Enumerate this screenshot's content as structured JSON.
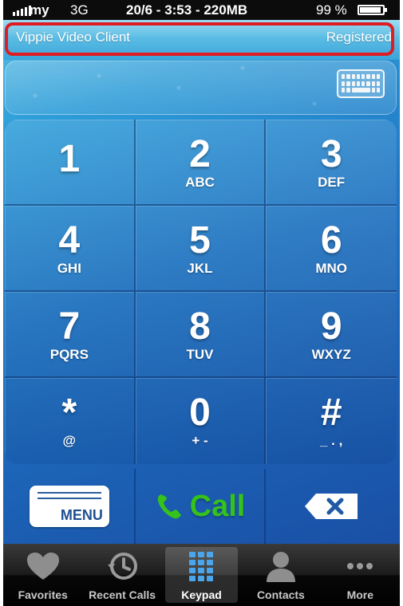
{
  "status_bar": {
    "carrier": "my",
    "network": "3G",
    "center_text": "20/6 - 3:53 - 220MB",
    "battery_percent": "99 %"
  },
  "header": {
    "title": "Vippie Video Client",
    "status": "Registered",
    "highlight_color": "#e01b22"
  },
  "display": {
    "number_value": "",
    "keyboard_icon": "keyboard-icon"
  },
  "keypad": {
    "keys": [
      {
        "digit": "1",
        "letters": ""
      },
      {
        "digit": "2",
        "letters": "ABC"
      },
      {
        "digit": "3",
        "letters": "DEF"
      },
      {
        "digit": "4",
        "letters": "GHI"
      },
      {
        "digit": "5",
        "letters": "JKL"
      },
      {
        "digit": "6",
        "letters": "MNO"
      },
      {
        "digit": "7",
        "letters": "PQRS"
      },
      {
        "digit": "8",
        "letters": "TUV"
      },
      {
        "digit": "9",
        "letters": "WXYZ"
      },
      {
        "digit": "*",
        "letters": "@"
      },
      {
        "digit": "0",
        "letters": "+ -"
      },
      {
        "digit": "#",
        "letters": "_ . ,"
      }
    ]
  },
  "actions": {
    "menu_label": "MENU",
    "call_label": "Call",
    "call_color": "#35c21b",
    "backspace_icon": "backspace-icon"
  },
  "tabbar": {
    "tabs": [
      {
        "label": "Favorites",
        "icon": "heart-icon"
      },
      {
        "label": "Recent Calls",
        "icon": "clock-icon"
      },
      {
        "label": "Keypad",
        "icon": "keypad-icon",
        "active": true
      },
      {
        "label": "Contacts",
        "icon": "person-icon"
      },
      {
        "label": "More",
        "icon": "more-icon"
      }
    ]
  }
}
